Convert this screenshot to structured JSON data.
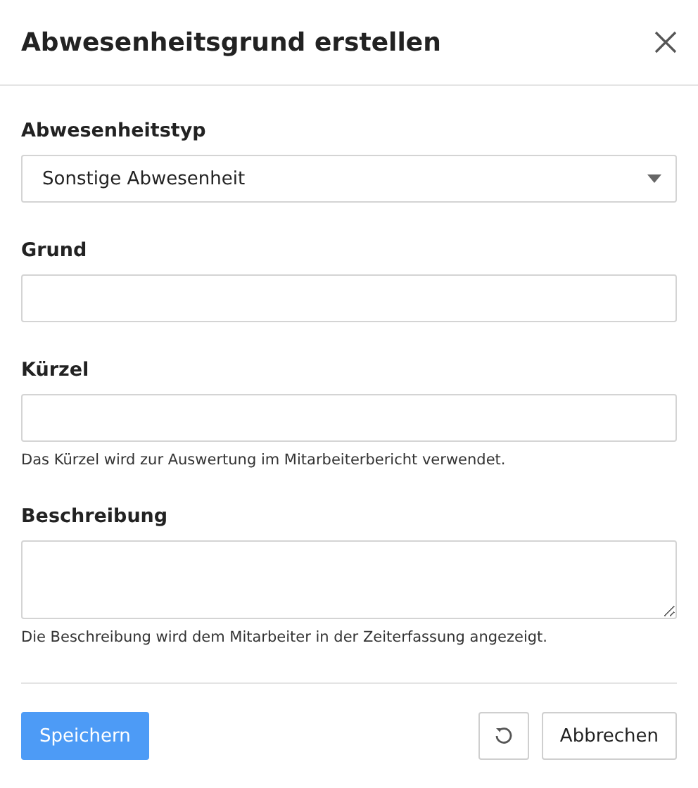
{
  "dialog": {
    "title": "Abwesenheitsgrund erstellen"
  },
  "fields": [
    {
      "kind": "select",
      "label": "Abwesenheitstyp",
      "value": "Sonstige Abwesenheit"
    },
    {
      "kind": "input",
      "label": "Grund"
    },
    {
      "kind": "input",
      "label": "Kürzel",
      "help": "Das Kürzel wird zur Auswertung im Mitarbeiterbericht verwendet."
    },
    {
      "kind": "textarea",
      "label": "Beschreibung",
      "help": "Die Beschreibung wird dem Mitarbeiter in der Zeiterfassung angezeigt."
    }
  ],
  "buttons": {
    "save": "Speichern",
    "cancel": "Abbrechen"
  }
}
